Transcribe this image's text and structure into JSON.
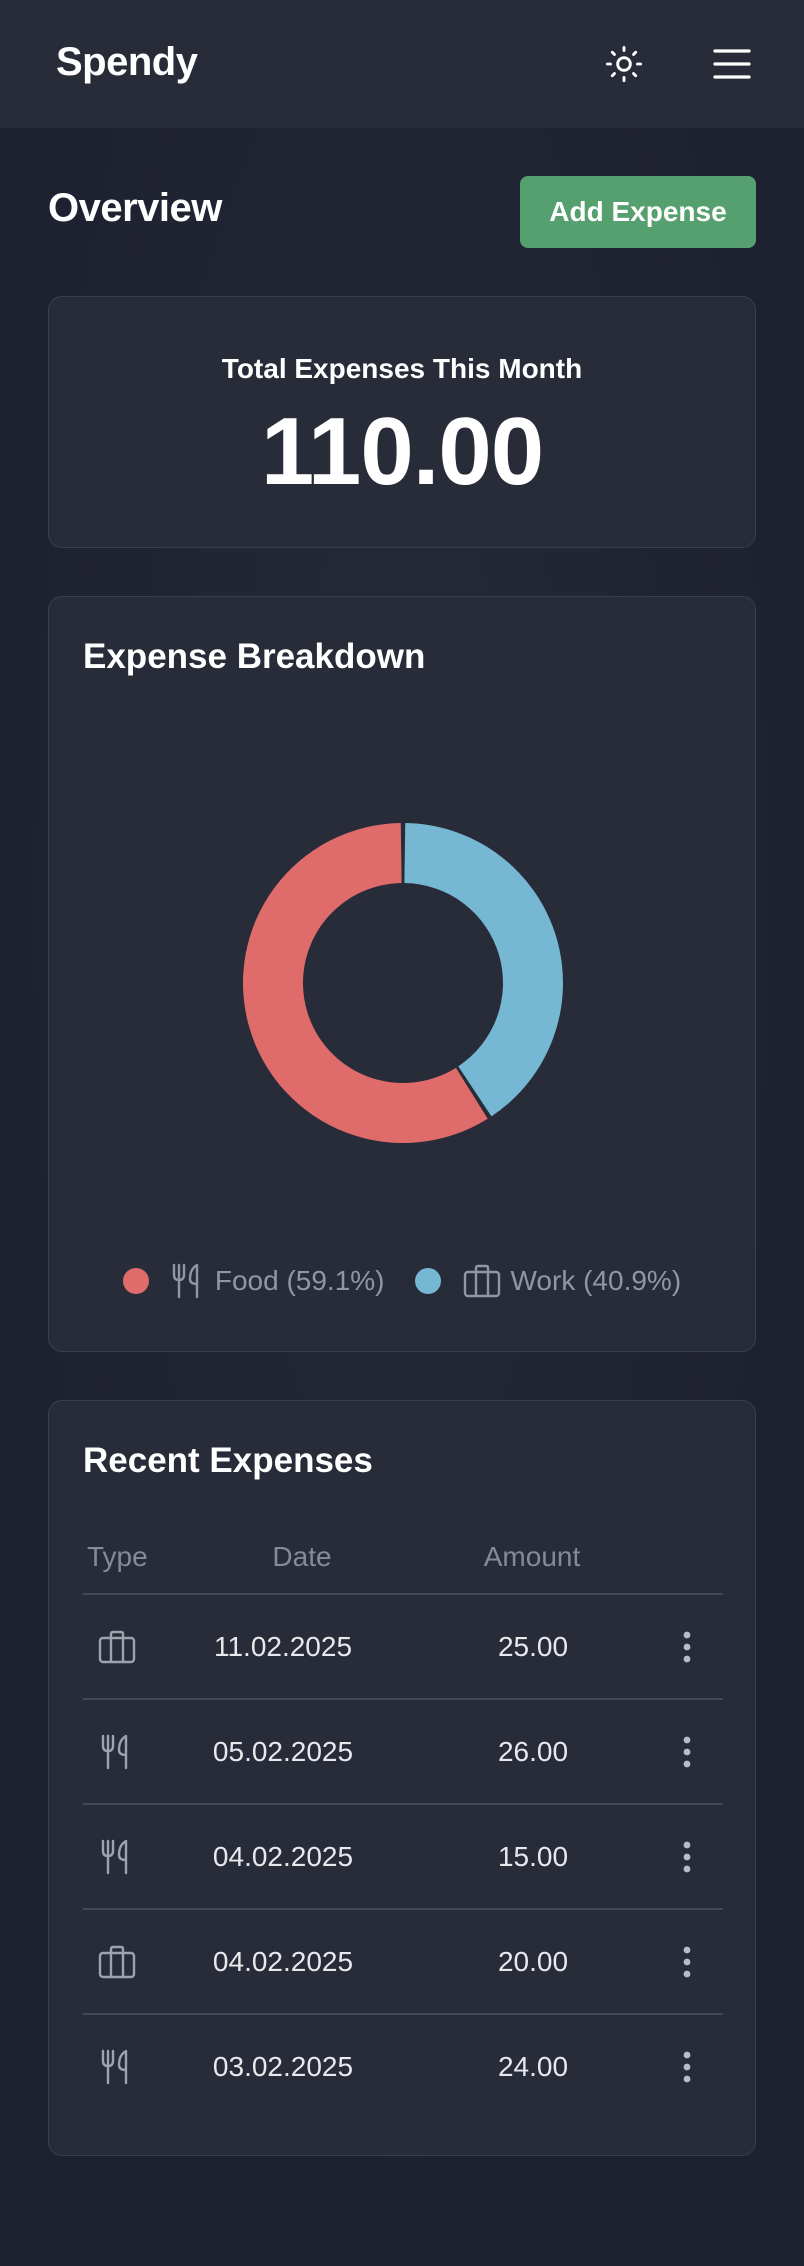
{
  "app": {
    "brand": "Spendy"
  },
  "header": {
    "theme_icon": "sun-icon",
    "menu_icon": "hamburger-menu-icon"
  },
  "overview": {
    "title": "Overview",
    "add_button_label": "Add Expense"
  },
  "total": {
    "label": "Total Expenses This Month",
    "value": "110.00"
  },
  "breakdown": {
    "title": "Expense Breakdown",
    "legend": [
      {
        "label": "Food (59.1%)",
        "icon": "fork-knife-icon",
        "color": "#e06b6b"
      },
      {
        "label": "Work (40.9%)",
        "icon": "briefcase-icon",
        "color": "#76b7d4"
      }
    ]
  },
  "chart_data": {
    "type": "pie",
    "categories": [
      "Food",
      "Work"
    ],
    "values": [
      59.1,
      40.9
    ],
    "colors": [
      "#e06b6b",
      "#76b7d4"
    ],
    "donut": true
  },
  "recent": {
    "title": "Recent Expenses",
    "columns": [
      "Type",
      "Date",
      "Amount"
    ],
    "rows": [
      {
        "type": "briefcase-icon",
        "date": "11.02.2025",
        "amount": "25.00"
      },
      {
        "type": "fork-knife-icon",
        "date": "05.02.2025",
        "amount": "26.00"
      },
      {
        "type": "fork-knife-icon",
        "date": "04.02.2025",
        "amount": "15.00"
      },
      {
        "type": "briefcase-icon",
        "date": "04.02.2025",
        "amount": "20.00"
      },
      {
        "type": "fork-knife-icon",
        "date": "03.02.2025",
        "amount": "24.00"
      }
    ]
  },
  "colors": {
    "accent": "#56a06f",
    "background": "#1f2230",
    "card": "#282c38",
    "muted": "#9196a2"
  }
}
